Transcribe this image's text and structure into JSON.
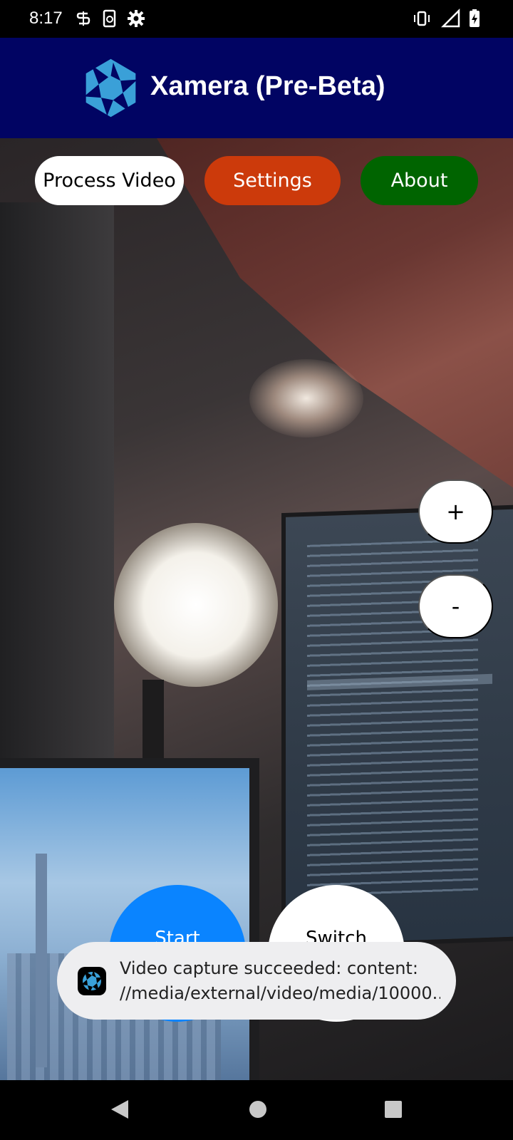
{
  "status_bar": {
    "time": "8:17",
    "left_icons": [
      "s-notification-icon",
      "phone-sync-icon",
      "gear-icon"
    ],
    "right_icons": [
      "vibrate-icon",
      "signal-icon",
      "battery-charging-icon"
    ]
  },
  "app_bar": {
    "title": "Xamera (Pre-Beta)",
    "logo_icon": "camera-aperture-icon"
  },
  "top_buttons": {
    "process_video": "Process Video",
    "settings": "Settings",
    "about": "About"
  },
  "zoom": {
    "in_label": "+",
    "out_label": "-"
  },
  "controls": {
    "start_label": "Start",
    "switch_label": "Switch"
  },
  "toast": {
    "message_line1": "Video capture succeeded: content:",
    "message_line2": "//media/external/video/media/10000..."
  },
  "nav_bar": {
    "icons": [
      "back-icon",
      "home-icon",
      "recents-icon"
    ]
  },
  "colors": {
    "app_bar": "#010463",
    "settings": "#cc3a0b",
    "about": "#006400",
    "start": "#0a84ff",
    "logo": "#3aa0d8"
  }
}
